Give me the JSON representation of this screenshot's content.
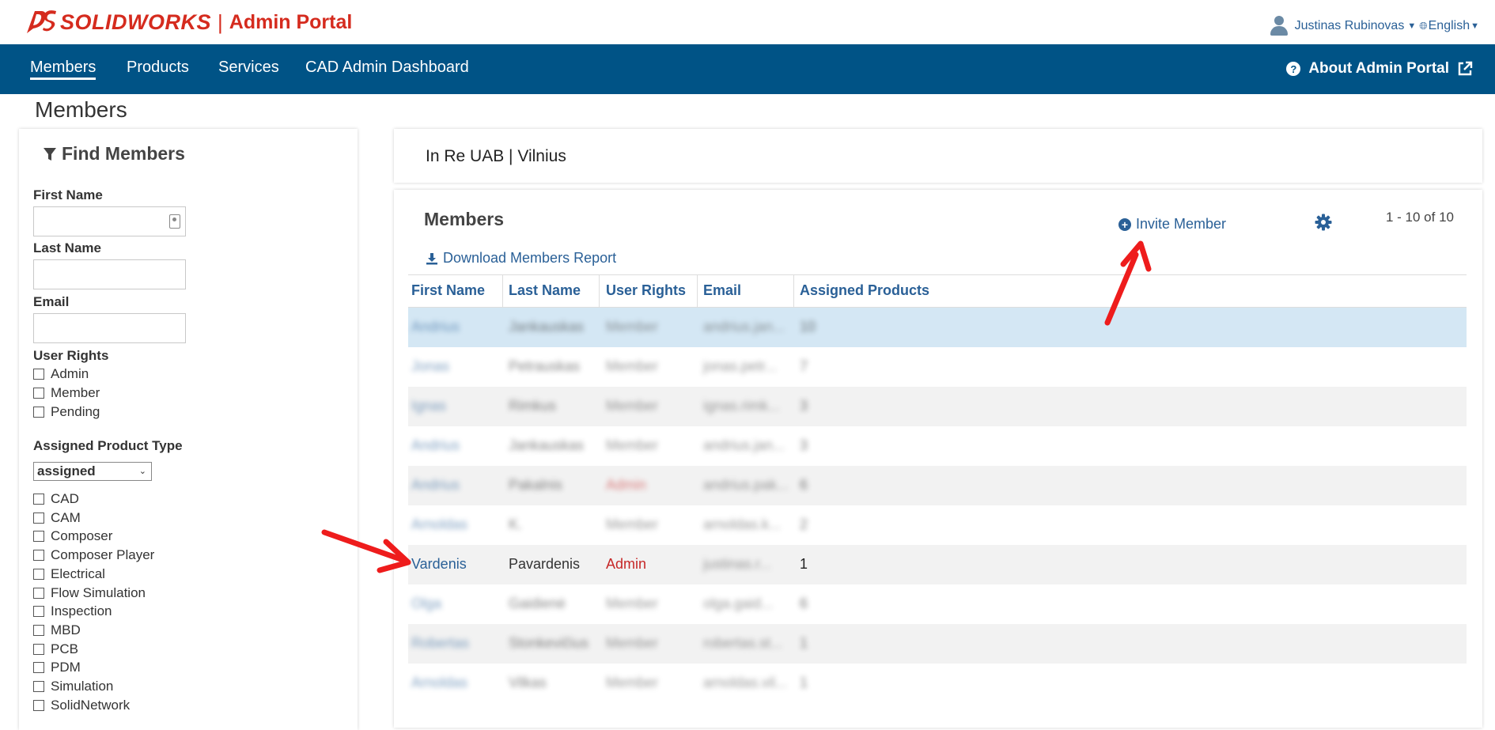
{
  "header": {
    "brand": "SOLIDWORKS",
    "separator": "|",
    "portal": "Admin Portal",
    "user_name": "Justinas Rubinovas",
    "language": "English"
  },
  "nav": {
    "items": [
      "Members",
      "Products",
      "Services",
      "CAD Admin Dashboard"
    ],
    "active": "Members",
    "about": "About Admin Portal"
  },
  "page_title": "Members",
  "sidebar": {
    "title": "Find Members",
    "first_name_label": "First Name",
    "last_name_label": "Last Name",
    "email_label": "Email",
    "user_rights_label": "User Rights",
    "user_rights": [
      "Admin",
      "Member",
      "Pending"
    ],
    "product_type_label": "Assigned Product Type",
    "product_type_value": "assigned",
    "products": [
      "CAD",
      "CAM",
      "Composer",
      "Composer Player",
      "Electrical",
      "Flow Simulation",
      "Inspection",
      "MBD",
      "PCB",
      "PDM",
      "Simulation",
      "SolidNetwork"
    ]
  },
  "org": {
    "name": "In Re UAB | Vilnius"
  },
  "members": {
    "title": "Members",
    "invite_label": "Invite Member",
    "pager": "1 - 10 of 10",
    "download_label": "Download Members Report",
    "columns": [
      "First Name",
      "Last Name",
      "User Rights",
      "Email",
      "Assigned Products"
    ],
    "rows": [
      {
        "first": "Andrius",
        "last": "Jankauskas",
        "rights": "Member",
        "email": "andrius.jan...",
        "products": "10",
        "blurred": true,
        "style": "sel"
      },
      {
        "first": "Jonas",
        "last": "Petrauskas",
        "rights": "Member",
        "email": "jonas.petr...",
        "products": "7",
        "blurred": true,
        "style": ""
      },
      {
        "first": "Ignas",
        "last": "Rimkus",
        "rights": "Member",
        "email": "ignas.rimk...",
        "products": "3",
        "blurred": true,
        "style": "alt"
      },
      {
        "first": "Andrius",
        "last": "Jankauskas",
        "rights": "Member",
        "email": "andrius.jan...",
        "products": "3",
        "blurred": true,
        "style": ""
      },
      {
        "first": "Andrius",
        "last": "Pakalnis",
        "rights": "Admin",
        "email": "andrius.pak...",
        "products": "6",
        "blurred": true,
        "style": "alt"
      },
      {
        "first": "Arnoldas",
        "last": "K.",
        "rights": "Member",
        "email": "arnoldas.k...",
        "products": "2",
        "blurred": true,
        "style": ""
      },
      {
        "first": "Vardenis",
        "last": "Pavardenis",
        "rights": "Admin",
        "email": "justinas.r...",
        "products": "1",
        "blurred": false,
        "style": "alt"
      },
      {
        "first": "Olga",
        "last": "Gaidienė",
        "rights": "Member",
        "email": "olga.gaid...",
        "products": "6",
        "blurred": true,
        "style": ""
      },
      {
        "first": "Robertas",
        "last": "Stonkevičius",
        "rights": "Member",
        "email": "robertas.st...",
        "products": "1",
        "blurred": true,
        "style": "alt"
      },
      {
        "first": "Arnoldas",
        "last": "Vilkas",
        "rights": "Member",
        "email": "arnoldas.vil...",
        "products": "1",
        "blurred": true,
        "style": ""
      }
    ]
  },
  "colors": {
    "brand_red": "#d52b1e",
    "nav_blue": "#005386",
    "link_blue": "#2a6097",
    "selected_row": "#d4e7f4",
    "admin_red": "#c62828",
    "annotation_red": "#ee1c1c"
  },
  "icons": [
    "user-icon",
    "globe-icon",
    "question-icon",
    "external-link-icon",
    "filter-icon",
    "contact-card-icon",
    "plus-circle-icon",
    "gear-icon",
    "download-icon",
    "chevron-down-icon"
  ]
}
